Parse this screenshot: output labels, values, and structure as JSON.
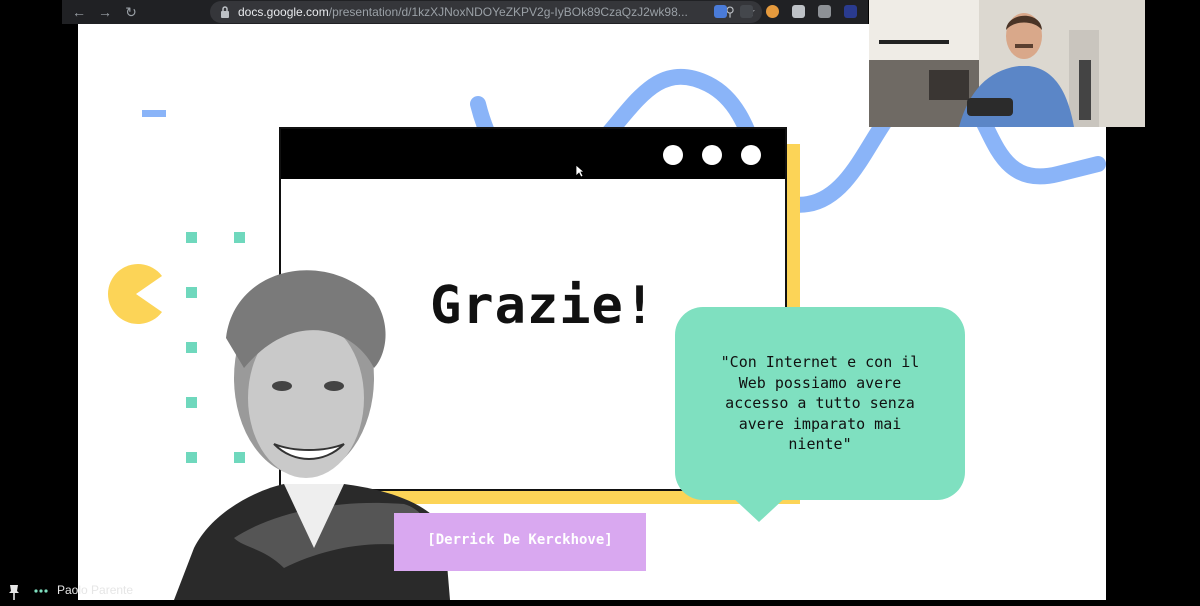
{
  "browser": {
    "url_domain": "docs.google.com",
    "url_path": "/presentation/d/1kzXJNoxNDOYeZKPV2g-IyBOk89CzaQzJ2wk98..."
  },
  "slide": {
    "title": "Grazie!",
    "quote": "\"Con Internet e con il Web possiamo avere accesso a tutto senza avere imparato mai niente\"",
    "quote_lines": [
      "\"Con Internet e con il",
      "Web possiamo avere",
      "accesso a tutto senza",
      "avere imparato mai",
      "niente\""
    ],
    "author": "[Derrick De Kerckhove]",
    "colors": {
      "accent_blue": "#8ab4f8",
      "accent_yellow": "#fcd457",
      "accent_mint": "#7fe0c0",
      "accent_teal_dots": "#6fd8bd",
      "accent_lilac": "#d9a8f0"
    }
  },
  "meeting": {
    "presenter_name": "Paolo Parente"
  },
  "icons": {
    "back": "arrow-left-icon",
    "forward": "arrow-right-icon",
    "reload": "reload-icon",
    "lock": "lock-icon",
    "zoom": "zoom-icon",
    "bookmark": "star-icon",
    "pin": "pin-icon",
    "more": "more-dots-icon"
  }
}
